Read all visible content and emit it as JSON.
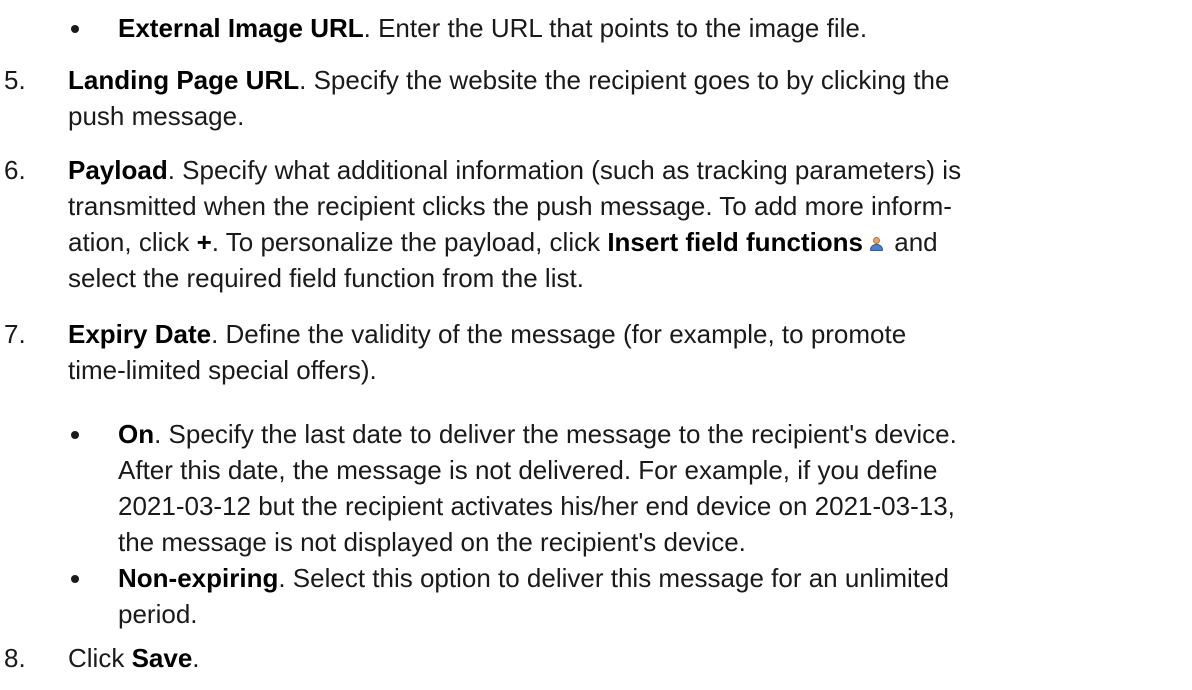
{
  "top_bullet": {
    "label": "External Image URL",
    "text": ". Enter the URL that points to the image file."
  },
  "steps": {
    "s5": {
      "num": "5.",
      "label": "Landing Page URL",
      "text_a": ". Specify the website the recipient goes to by clicking the",
      "text_b": "push message."
    },
    "s6": {
      "num": "6.",
      "label": "Payload",
      "text_a": ". Specify what additional information (such as tracking parameters) is",
      "text_b": "transmitted when the recipient clicks the push message. To add more inform-",
      "text_c1": "ation, click ",
      "plus": "+",
      "text_c2": ". To personalize the payload, click ",
      "insert_label": "Insert field functions",
      "text_c3": " and",
      "text_d": "select the required field function from the list.",
      "icon": "person-icon"
    },
    "s7": {
      "num": "7.",
      "label": "Expiry Date",
      "text_a": ". Define the validity of the message (for example, to promote",
      "text_b": "time-limited special offers).",
      "options": {
        "on": {
          "label": "On",
          "text_a": ". Specify the last date to deliver the message to the recipient's device.",
          "text_b": "After this date, the message is not delivered. For example, if you define",
          "text_c": "2021-03-12 but the recipient activates his/her end device on 2021-03-13,",
          "text_d": "the message is not displayed on the recipient's device."
        },
        "nonexp": {
          "label": "Non-expiring",
          "text_a": ". Select this option to deliver this message for an unlimited",
          "text_b": "period."
        }
      }
    },
    "s8": {
      "num": "8.",
      "text_a": "Click ",
      "label": "Save",
      "text_b": "."
    }
  }
}
